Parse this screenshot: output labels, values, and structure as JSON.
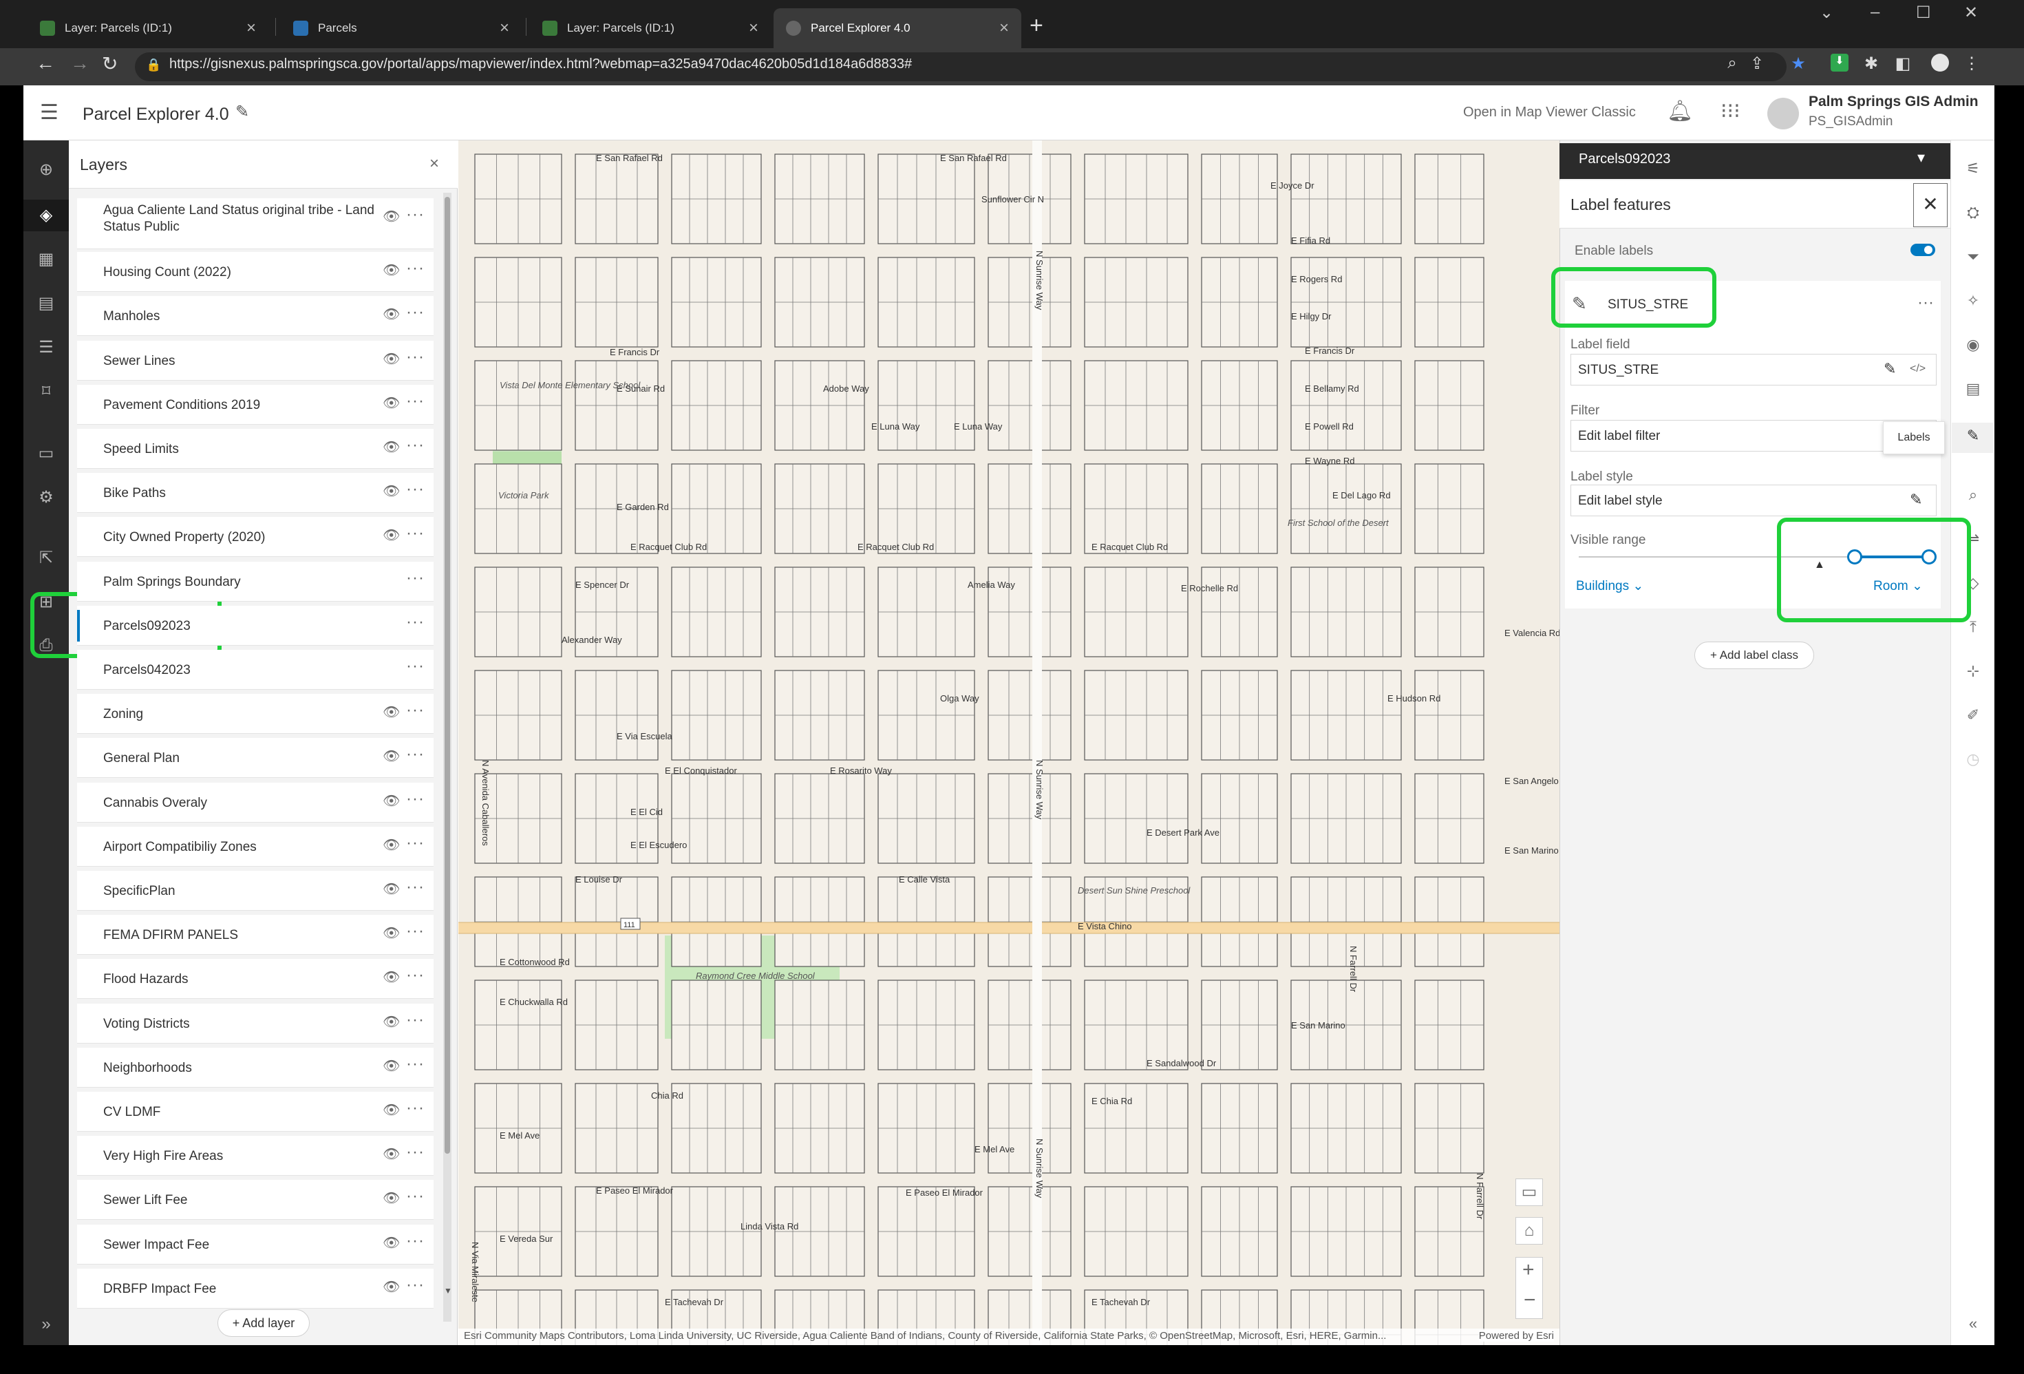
{
  "browser": {
    "tabs": [
      {
        "title": "Layer: Parcels (ID:1)",
        "active": false
      },
      {
        "title": "Parcels",
        "active": false
      },
      {
        "title": "Layer: Parcels (ID:1)",
        "active": false
      },
      {
        "title": "Parcel Explorer 4.0",
        "active": true
      }
    ],
    "url": "https://gisnexus.palmspringsca.gov/portal/apps/mapviewer/index.html?webmap=a325a9470dac4620b05d1d184a6d8833#"
  },
  "header": {
    "title": "Parcel Explorer 4.0",
    "open_classic": "Open in Map Viewer Classic",
    "user_name": "Palm Springs GIS Admin",
    "user_id": "PS_GISAdmin"
  },
  "layers_panel": {
    "title": "Layers",
    "add_layer": "Add layer",
    "layers": [
      {
        "name": "Agua Caliente Land Status original tribe - Land Status Public",
        "visible": true
      },
      {
        "name": "Housing Count (2022)",
        "visible": true
      },
      {
        "name": "Manholes",
        "visible": true
      },
      {
        "name": "Sewer Lines",
        "visible": true
      },
      {
        "name": "Pavement Conditions 2019",
        "visible": true
      },
      {
        "name": "Speed Limits",
        "visible": true
      },
      {
        "name": "Bike Paths",
        "visible": true
      },
      {
        "name": "City Owned Property (2020)",
        "visible": true
      },
      {
        "name": "Palm Springs Boundary",
        "visible": false
      },
      {
        "name": "Parcels092023",
        "visible": false,
        "selected": true
      },
      {
        "name": "Parcels042023",
        "visible": false
      },
      {
        "name": "Zoning",
        "visible": true
      },
      {
        "name": "General Plan",
        "visible": true
      },
      {
        "name": "Cannabis Overaly",
        "visible": true
      },
      {
        "name": "Airport Compatibiliy Zones",
        "visible": true
      },
      {
        "name": "SpecificPlan",
        "visible": true
      },
      {
        "name": "FEMA DFIRM PANELS",
        "visible": true
      },
      {
        "name": "Flood Hazards",
        "visible": true
      },
      {
        "name": "Voting Districts",
        "visible": true
      },
      {
        "name": "Neighborhoods",
        "visible": true
      },
      {
        "name": "CV LDMF",
        "visible": true
      },
      {
        "name": "Very High Fire Areas",
        "visible": true
      },
      {
        "name": "Sewer Lift Fee",
        "visible": true
      },
      {
        "name": "Sewer Impact Fee",
        "visible": true
      },
      {
        "name": "DRBFP Impact Fee",
        "visible": true
      }
    ]
  },
  "map": {
    "streets": [
      "E San Rafael Rd",
      "E San Rafael Rd",
      "Sunflower Cir N",
      "E Joyce Dr",
      "E Fifia Rd",
      "E Rogers Rd",
      "E Hilgy Dr",
      "E Francis Dr",
      "E Francis Dr",
      "E Sunair Rd",
      "Adobe Way",
      "E Bellamy Rd",
      "E Luna Way",
      "E Luna Way",
      "E Powell Rd",
      "E Wayne Rd",
      "E Garden Rd",
      "E Del Lago Rd",
      "E Racquet Club Rd",
      "E Racquet Club Rd",
      "E Racquet Club Rd",
      "E Spencer Dr",
      "Amelia Way",
      "E Rochelle Rd",
      "Alexander Way",
      "E Hudson Rd",
      "Olga Way",
      "E Via Escuela",
      "E El Conquistador",
      "E Rosarito Way",
      "E El Cid",
      "E El Escudero",
      "E Desert Park Ave",
      "E Louise Dr",
      "E Calle Vista",
      "E Vista Chino",
      "E Cottonwood Rd",
      "E Chuckwalla Rd",
      "E Sandalwood Dr",
      "E Chia Rd",
      "Chia Rd",
      "E Mel Ave",
      "E Mel Ave",
      "E Paseo El Mirador",
      "E Paseo El Mirador",
      "E Vereda Sur",
      "Linda Vista Rd",
      "E Tachevah Dr",
      "E Tachevah Dr",
      "N Sunrise Way",
      "N Sunrise Way",
      "N Sunrise Way",
      "N Farrell Dr",
      "N Farrell Dr",
      "N Avenida Caballeros",
      "N Via Miraleste",
      "E Valencia Rd",
      "E San Angelo",
      "E San Marino"
    ],
    "places": [
      "Vista Del Monte Elementary School",
      "Victoria Park",
      "First School of the Desert",
      "Raymond Cree Middle School",
      "Desert Sun Shine Preschool"
    ],
    "route": "111",
    "attribution": "Esri Community Maps Contributors, Loma Linda University, UC Riverside, Agua Caliente Band of Indians, County of Riverside, California State Parks, © OpenStreetMap, Microsoft, Esri, HERE, Garmin...",
    "powered_by": "Powered by Esri"
  },
  "label_panel": {
    "layer_select": "Parcels092023",
    "title": "Label features",
    "enable_labels": "Enable labels",
    "enabled": true,
    "class_name": "SITUS_STRE",
    "label_field_label": "Label field",
    "label_field_value": "SITUS_STRE",
    "filter_label": "Filter",
    "filter_value": "Edit label filter",
    "style_label": "Label style",
    "style_value": "Edit label style",
    "range_label": "Visible range",
    "range_min": "Buildings",
    "range_max": "Room",
    "add_label_class": "Add label class",
    "tooltip": "Labels"
  },
  "colors": {
    "accent": "#0079c1",
    "highlight": "#1fd03a"
  }
}
